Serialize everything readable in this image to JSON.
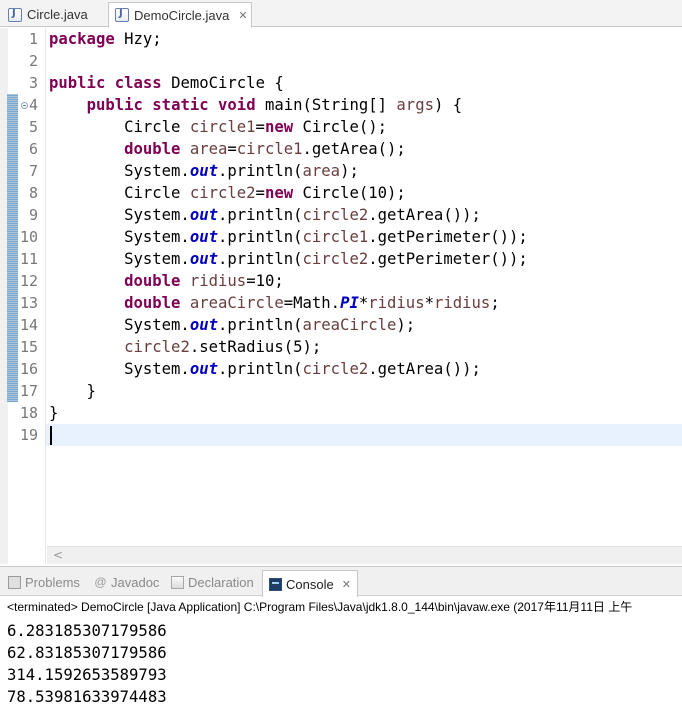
{
  "editor_tabs": [
    {
      "label": "Circle.java"
    },
    {
      "label": "DemoCircle.java",
      "close": "✕"
    }
  ],
  "line_numbers": [
    "1",
    "2",
    "3",
    "4",
    "5",
    "6",
    "7",
    "8",
    "9",
    "10",
    "11",
    "12",
    "13",
    "14",
    "15",
    "16",
    "17",
    "18",
    "19"
  ],
  "code_lines": [
    [
      {
        "t": "package",
        "c": "kw"
      },
      {
        "t": " Hzy;"
      }
    ],
    [],
    [
      {
        "t": "public",
        "c": "kw"
      },
      {
        "t": " "
      },
      {
        "t": "class",
        "c": "kw"
      },
      {
        "t": " DemoCircle {"
      }
    ],
    [
      {
        "t": "    "
      },
      {
        "t": "public",
        "c": "kw"
      },
      {
        "t": " "
      },
      {
        "t": "static",
        "c": "kw"
      },
      {
        "t": " "
      },
      {
        "t": "void",
        "c": "kw"
      },
      {
        "t": " main(String[] "
      },
      {
        "t": "args",
        "c": "var"
      },
      {
        "t": ") {"
      }
    ],
    [
      {
        "t": "        Circle "
      },
      {
        "t": "circle1",
        "c": "var"
      },
      {
        "t": "="
      },
      {
        "t": "new",
        "c": "kw"
      },
      {
        "t": " Circle();"
      }
    ],
    [
      {
        "t": "        "
      },
      {
        "t": "double",
        "c": "kw"
      },
      {
        "t": " "
      },
      {
        "t": "area",
        "c": "var"
      },
      {
        "t": "="
      },
      {
        "t": "circle1",
        "c": "var"
      },
      {
        "t": ".getArea();"
      }
    ],
    [
      {
        "t": "        System."
      },
      {
        "t": "out",
        "c": "fld"
      },
      {
        "t": ".println("
      },
      {
        "t": "area",
        "c": "var"
      },
      {
        "t": ");"
      }
    ],
    [
      {
        "t": "        Circle "
      },
      {
        "t": "circle2",
        "c": "var"
      },
      {
        "t": "="
      },
      {
        "t": "new",
        "c": "kw"
      },
      {
        "t": " Circle(10);"
      }
    ],
    [
      {
        "t": "        System."
      },
      {
        "t": "out",
        "c": "fld"
      },
      {
        "t": ".println("
      },
      {
        "t": "circle2",
        "c": "var"
      },
      {
        "t": ".getArea());"
      }
    ],
    [
      {
        "t": "        System."
      },
      {
        "t": "out",
        "c": "fld"
      },
      {
        "t": ".println("
      },
      {
        "t": "circle1",
        "c": "var"
      },
      {
        "t": ".getPerimeter());"
      }
    ],
    [
      {
        "t": "        System."
      },
      {
        "t": "out",
        "c": "fld"
      },
      {
        "t": ".println("
      },
      {
        "t": "circle2",
        "c": "var"
      },
      {
        "t": ".getPerimeter());"
      }
    ],
    [
      {
        "t": "        "
      },
      {
        "t": "double",
        "c": "kw"
      },
      {
        "t": " "
      },
      {
        "t": "ridius",
        "c": "var"
      },
      {
        "t": "=10;"
      }
    ],
    [
      {
        "t": "        "
      },
      {
        "t": "double",
        "c": "kw"
      },
      {
        "t": " "
      },
      {
        "t": "areaCircle",
        "c": "var"
      },
      {
        "t": "=Math."
      },
      {
        "t": "PI",
        "c": "fld"
      },
      {
        "t": "*"
      },
      {
        "t": "ridius",
        "c": "var"
      },
      {
        "t": "*"
      },
      {
        "t": "ridius",
        "c": "var"
      },
      {
        "t": ";"
      }
    ],
    [
      {
        "t": "        System."
      },
      {
        "t": "out",
        "c": "fld"
      },
      {
        "t": ".println("
      },
      {
        "t": "areaCircle",
        "c": "var"
      },
      {
        "t": ");"
      }
    ],
    [
      {
        "t": "        "
      },
      {
        "t": "circle2",
        "c": "var"
      },
      {
        "t": ".setRadius(5);"
      }
    ],
    [
      {
        "t": "        System."
      },
      {
        "t": "out",
        "c": "fld"
      },
      {
        "t": ".println("
      },
      {
        "t": "circle2",
        "c": "var"
      },
      {
        "t": ".getArea());"
      }
    ],
    [
      {
        "t": "    }"
      }
    ],
    [
      {
        "t": "}"
      }
    ],
    []
  ],
  "scroll_arrow": "<",
  "view_tabs": [
    {
      "label": "Problems",
      "icon": "problems-icon"
    },
    {
      "label": "Javadoc",
      "icon": "javadoc-icon",
      "glyph": "@"
    },
    {
      "label": "Declaration",
      "icon": "declaration-icon"
    },
    {
      "label": "Console",
      "icon": "console-icon",
      "close": "✕"
    }
  ],
  "console": {
    "status": "<terminated> DemoCircle [Java Application] C:\\Program Files\\Java\\jdk1.8.0_144\\bin\\javaw.exe (2017年11月11日 上午",
    "output": [
      "6.283185307179586",
      "62.83185307179586",
      "314.1592653589793",
      "78.53981633974483"
    ]
  },
  "colors": {
    "keyword": "#7f0055",
    "local_variable": "#6a3e3e",
    "static_field": "#0000c0",
    "current_line": "#e8f2fe"
  }
}
